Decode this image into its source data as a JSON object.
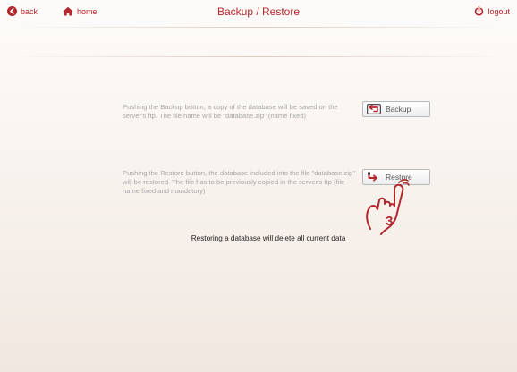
{
  "header": {
    "back_label": "back",
    "home_label": "home",
    "title": "Backup / Restore",
    "logout_label": "logout"
  },
  "backup": {
    "description": "Pushing the Backup button, a copy of the database will be saved on the server's ftp. The file name will be \"database.zip\" (name fixed)",
    "button_label": "Backup",
    "icon": "backup-arrow-icon"
  },
  "restore": {
    "description": "Pushing the Restore button, the database included into the file \"database.zip\" will be restored. The file has to be previously copied in the server's ftp (file name fixed and mandatory)",
    "button_label": "Restore",
    "icon": "restore-arrow-icon"
  },
  "warning": "Restoring a database will delete all current data",
  "pointer": {
    "step_number": "3",
    "icon": "hand-pointer-icon"
  },
  "colors": {
    "accent": "#b3272d",
    "text_muted": "#a7a7a7",
    "warning_text": "#222222"
  }
}
